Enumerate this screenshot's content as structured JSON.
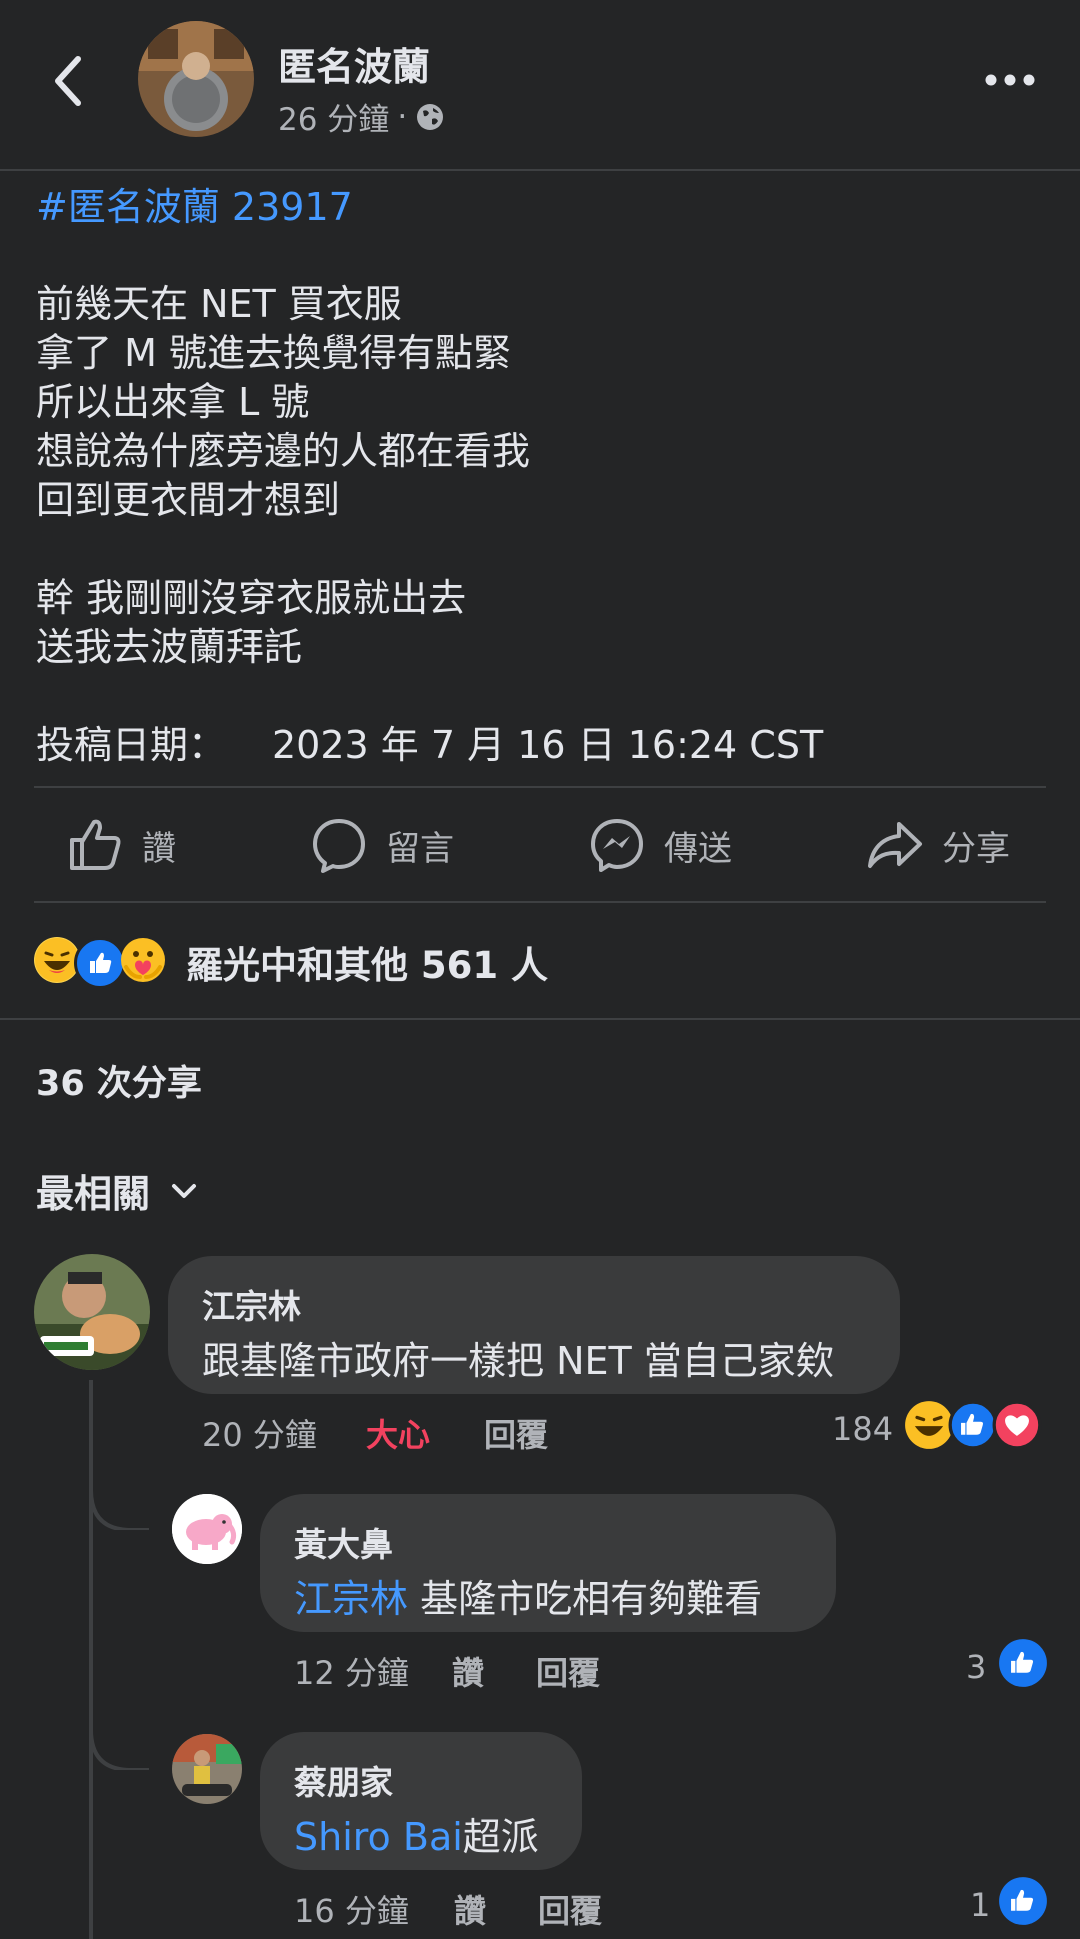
{
  "header": {
    "page_name": "匿名波蘭",
    "post_time": "26 分鐘",
    "dot": "·"
  },
  "post": {
    "hashtag": "#匿名波蘭 23917",
    "lines": [
      "前幾天在 NET 買衣服",
      "拿了 M 號進去換覺得有點緊",
      "所以出來拿 L 號",
      "想說為什麼旁邊的人都在看我",
      "回到更衣間才想到",
      "幹 我剛剛沒穿衣服就出去",
      "送我去波蘭拜託"
    ],
    "date_label": "投稿日期：",
    "date_value": "2023 年 7 月 16 日 16:24 CST"
  },
  "actions": {
    "like": "讚",
    "comment": "留言",
    "send": "傳送",
    "share": "分享"
  },
  "reactions": {
    "summary": "羅光中和其他 561 人",
    "icons": [
      "haha-reaction-icon",
      "like-reaction-icon",
      "care-reaction-icon"
    ]
  },
  "shares": "36 次分享",
  "sort_label": "最相關",
  "comments": [
    {
      "name": "江宗林",
      "text": "跟基隆市政府一樣把 NET 當自己家欸",
      "time": "20 分鐘",
      "reaction_label": "大心",
      "reply": "回覆",
      "count": "184"
    },
    {
      "name": "黃大鼻",
      "mention": "江宗林",
      "text": " 基隆市吃相有夠難看",
      "time": "12 分鐘",
      "like": "讚",
      "reply": "回覆",
      "count": "3"
    },
    {
      "name": "蔡朋家",
      "mention": "Shiro Bai",
      "text": "超派",
      "time": "16 分鐘",
      "like": "讚",
      "reply": "回覆",
      "count": "1"
    }
  ],
  "colors": {
    "background": "#242526",
    "bubble": "#3a3b3c",
    "link": "#4599ff",
    "love": "#f3425f",
    "like": "#1877f2"
  }
}
